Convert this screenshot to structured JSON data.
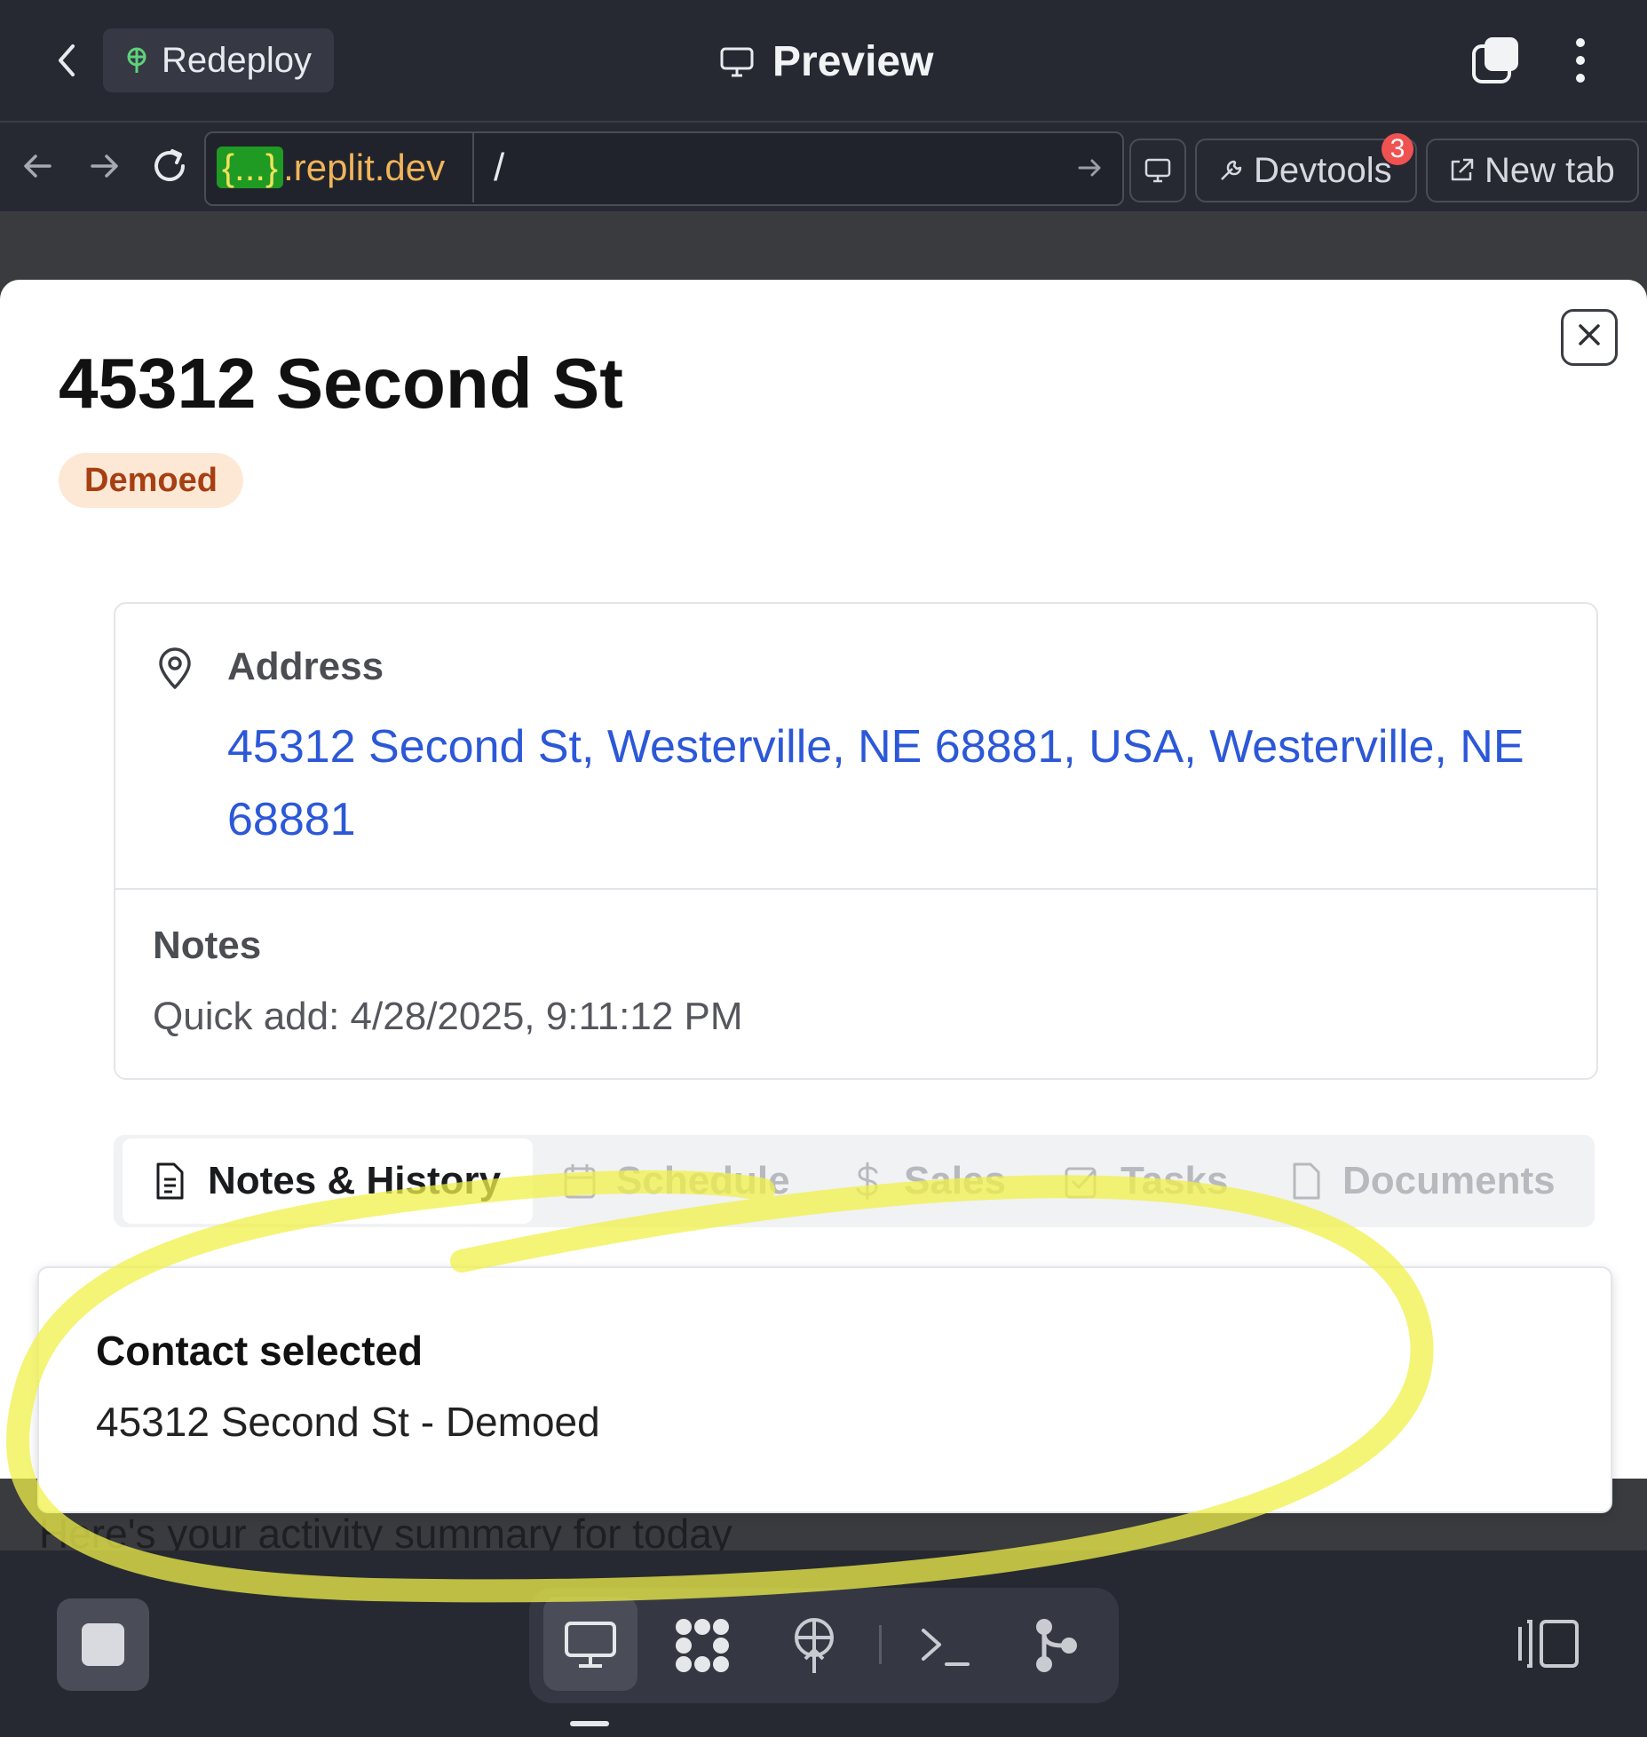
{
  "topbar": {
    "redeploy_label": "Redeploy",
    "title": "Preview"
  },
  "navbar": {
    "url_highlight": "{...}",
    "url_domain": ".replit.dev",
    "url_path": "/",
    "devtools_label": "Devtools",
    "devtools_badge": "3",
    "new_tab_label": "New tab"
  },
  "modal": {
    "title": "45312 Second St",
    "status": "Demoed",
    "address_label": "Address",
    "address_value": "45312 Second St, Westerville, NE 68881, USA, Westerville, NE 68881",
    "notes_label": "Notes",
    "notes_value": "Quick add: 4/28/2025, 9:11:12 PM",
    "tabs": [
      {
        "label": "Notes & History",
        "icon": "document-icon",
        "active": true
      },
      {
        "label": "Schedule",
        "icon": "calendar-icon",
        "active": false
      },
      {
        "label": "Sales",
        "icon": "dollar-icon",
        "active": false
      },
      {
        "label": "Tasks",
        "icon": "checkbox-icon",
        "active": false
      },
      {
        "label": "Documents",
        "icon": "file-icon",
        "active": false
      }
    ]
  },
  "toast": {
    "title": "Contact selected",
    "description": "45312 Second St - Demoed"
  },
  "background": {
    "summary_text": "Here's your activity summary for today"
  },
  "colors": {
    "accent_link": "#2c58d8",
    "status_badge_bg": "#fde8d6",
    "status_badge_text": "#a63f12",
    "annotation": "#f0f04a",
    "chrome_bg": "#262932"
  }
}
